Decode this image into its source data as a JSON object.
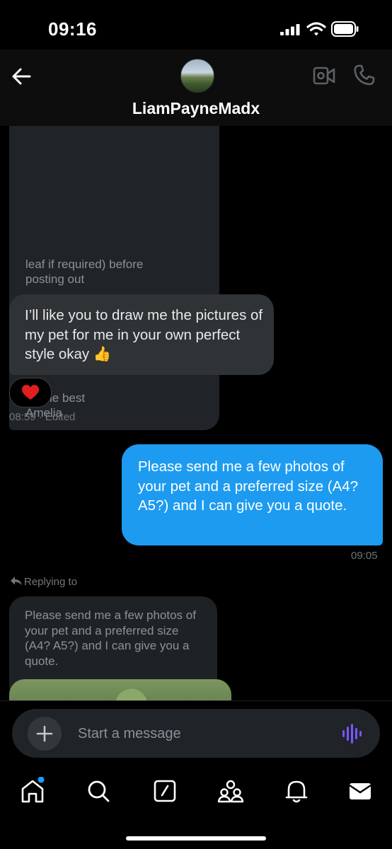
{
  "status_bar": {
    "time": "09:16"
  },
  "header": {
    "contact_name": "LiamPayneMadx"
  },
  "messages": {
    "received_long": "leaf if required) before\nposting out\n\nMany thanks for your interest\nand\nLook forward to hearing from\nyou if you wish to engage my\nservices\n\nAll the best\nAmelia",
    "received_draw": "I’ll like you to draw me the pictures of my pet for me in your own perfect style okay 👍",
    "reaction": "❤️",
    "received_draw_meta": "08:59 · Edited",
    "sent_quote": "Please send me a few photos of your pet and a preferred size (A4? A5?) and I can give you a quote.",
    "sent_quote_time": "09:05",
    "replying_label": "Replying to",
    "quoted_text": "Please send me a few photos of your pet and a preferred size (A4? A5?) and I can give you a quote."
  },
  "composer": {
    "placeholder": "Start a message"
  },
  "colors": {
    "accent": "#1d9bf0",
    "voice": "#7856ff",
    "bubble_in": "#2f3336",
    "notification_dot": "#1d9bf0"
  },
  "icons": {
    "back": "arrow-left-icon",
    "video": "video-camera-icon",
    "call": "phone-icon",
    "add": "plus-icon",
    "voice": "voice-wave-icon",
    "scroll": "arrow-down-icon",
    "tabs": [
      "home-icon",
      "search-icon",
      "compose-icon",
      "communities-icon",
      "notifications-icon",
      "messages-icon"
    ]
  }
}
